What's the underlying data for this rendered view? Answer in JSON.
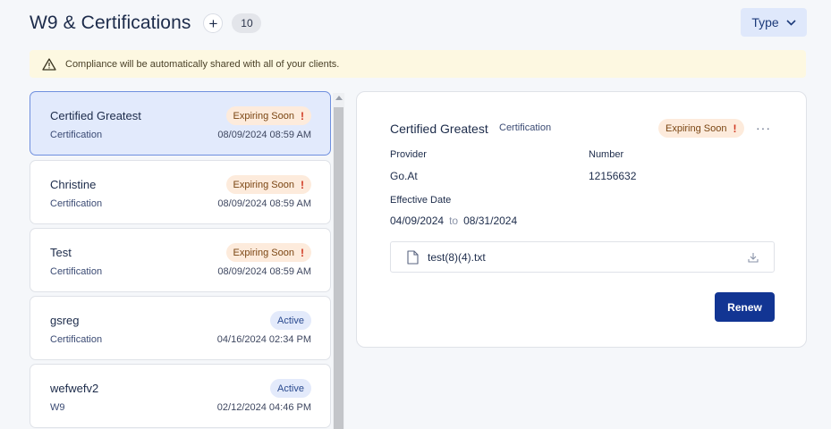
{
  "header": {
    "title": "W9 & Certifications",
    "add_label": "+",
    "count": "10",
    "type_filter_label": "Type"
  },
  "banner": {
    "text": "Compliance will be automatically shared with all of your clients."
  },
  "list": {
    "items": [
      {
        "name": "Certified Greatest",
        "type": "Certification",
        "date": "08/09/2024 08:59 AM",
        "status": "Expiring Soon",
        "status_icon": "!"
      },
      {
        "name": "Christine",
        "type": "Certification",
        "date": "08/09/2024 08:59 AM",
        "status": "Expiring Soon",
        "status_icon": "!"
      },
      {
        "name": "Test",
        "type": "Certification",
        "date": "08/09/2024 08:59 AM",
        "status": "Expiring Soon",
        "status_icon": "!"
      },
      {
        "name": "gsreg",
        "type": "Certification",
        "date": "04/16/2024 02:34 PM",
        "status": "Active"
      },
      {
        "name": "wefwefv2",
        "type": "W9",
        "date": "02/12/2024 04:46 PM",
        "status": "Active"
      }
    ]
  },
  "detail": {
    "title": "Certified Greatest",
    "type": "Certification",
    "status": "Expiring Soon",
    "status_icon": "!",
    "more_label": "···",
    "provider_label": "Provider",
    "provider_value": "Go.At",
    "number_label": "Number",
    "number_value": "12156632",
    "effective_label": "Effective Date",
    "effective_start": "04/09/2024",
    "effective_to": "to",
    "effective_end": "08/31/2024",
    "file_name": "test(8)(4).txt",
    "renew_label": "Renew"
  },
  "colors": {
    "primary": "#123593",
    "selected_bg": "#e2eafc",
    "expiring_bg": "#fdebdc",
    "active_bg": "#e3eafb",
    "banner_bg": "#fdf8e1"
  }
}
